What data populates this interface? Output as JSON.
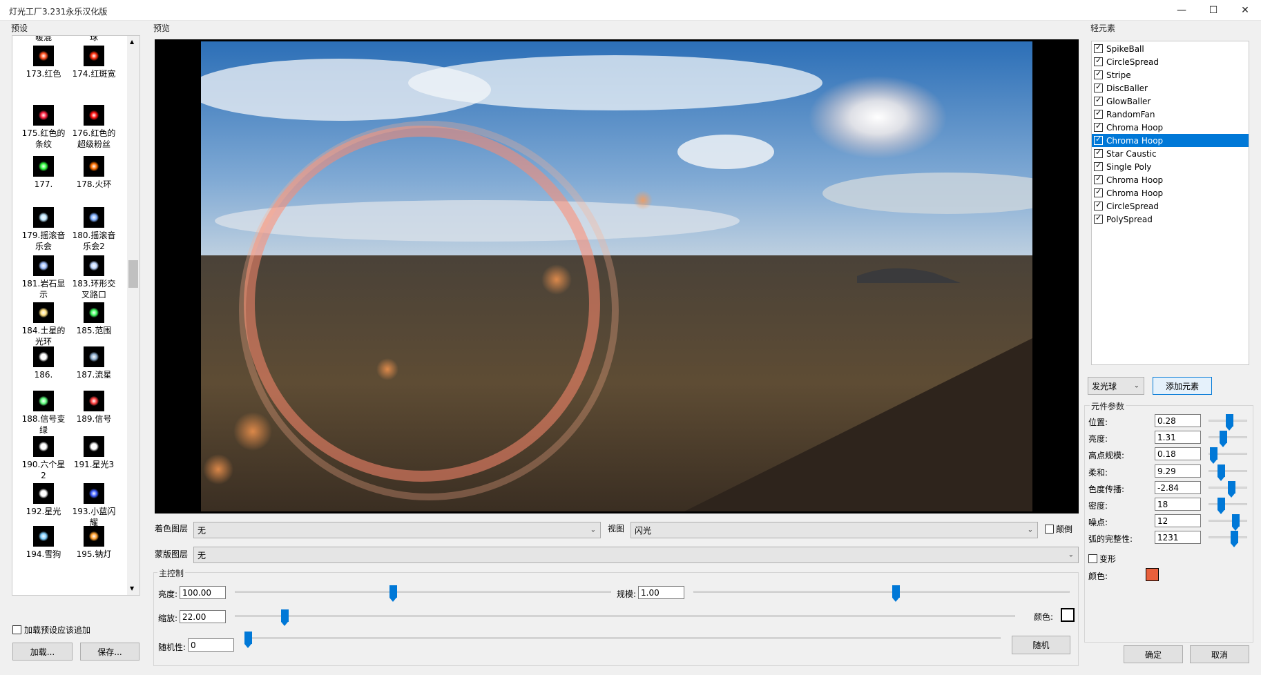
{
  "window": {
    "title": "灯光工厂3.231永乐汉化版"
  },
  "presets": {
    "group_label": "预设",
    "top_partial": [
      "暖混",
      "球"
    ],
    "items": [
      {
        "label": "173.红色",
        "glow": "#ff5020"
      },
      {
        "label": "174.红斑宽",
        "glow": "#ff3010"
      },
      {
        "label": "175.红色的条纹",
        "glow": "#ff2040"
      },
      {
        "label": "176.红色的超级粉丝",
        "glow": "#ff1010"
      },
      {
        "label": "177.",
        "glow": "#30ff40"
      },
      {
        "label": "178.火环",
        "glow": "#ff7000"
      },
      {
        "label": "179.摇滚音乐会",
        "glow": "#c0e8ff"
      },
      {
        "label": "180.摇滚音乐会2",
        "glow": "#80b0ff"
      },
      {
        "label": "181.岩石显示",
        "glow": "#a0c0ff"
      },
      {
        "label": "183.环形交叉路口",
        "glow": "#c0d8ff"
      },
      {
        "label": "184.土星的光环",
        "glow": "#ffe080"
      },
      {
        "label": "185.范围",
        "glow": "#40ff60"
      },
      {
        "label": "186.",
        "glow": "#ffffff"
      },
      {
        "label": "187.流星",
        "glow": "#90b0d0"
      },
      {
        "label": "188.信号变绿",
        "glow": "#60ff80"
      },
      {
        "label": "189.信号",
        "glow": "#ff4040"
      },
      {
        "label": "190.六个星 2",
        "glow": "#ffffff"
      },
      {
        "label": "191.星光3",
        "glow": "#ffffff"
      },
      {
        "label": "192.星光",
        "glow": "#ffffff"
      },
      {
        "label": "193.小蓝闪耀",
        "glow": "#4060ff"
      },
      {
        "label": "194.雪狗",
        "glow": "#80d0ff"
      },
      {
        "label": "195.钠灯",
        "glow": "#ffa030"
      }
    ],
    "append_checkbox": "加载预设应该追加",
    "load_button": "加载...",
    "save_button": "保存..."
  },
  "preview": {
    "group_label": "预览",
    "color_layer_label": "着色图层",
    "color_layer_value": "无",
    "view_label": "视图",
    "view_value": "闪光",
    "invert_label": "颠倒",
    "mask_layer_label": "蒙版图层",
    "mask_layer_value": "无"
  },
  "master": {
    "group_label": "主控制",
    "brightness_label": "亮度:",
    "brightness_value": "100.00",
    "brightness_level": 0.42,
    "scale_label": "规模:",
    "scale_value": "1.00",
    "scale_level": 0.54,
    "zoom_label": "缩放:",
    "zoom_value": "22.00",
    "zoom_level": 0.06,
    "color_label": "颜色:",
    "random_label": "随机性:",
    "random_value": "0",
    "random_level": 0.0,
    "random_button": "随机"
  },
  "elements": {
    "group_label": "轻元素",
    "items": [
      {
        "label": "SpikeBall",
        "selected": false
      },
      {
        "label": "CircleSpread",
        "selected": false
      },
      {
        "label": "Stripe",
        "selected": false
      },
      {
        "label": "DiscBaller",
        "selected": false
      },
      {
        "label": "GlowBaller",
        "selected": false
      },
      {
        "label": "RandomFan",
        "selected": false
      },
      {
        "label": "Chroma Hoop",
        "selected": false
      },
      {
        "label": "Chroma Hoop",
        "selected": true
      },
      {
        "label": "Star Caustic",
        "selected": false
      },
      {
        "label": "Single Poly",
        "selected": false
      },
      {
        "label": "Chroma Hoop",
        "selected": false
      },
      {
        "label": "Chroma Hoop",
        "selected": false
      },
      {
        "label": "CircleSpread",
        "selected": false
      },
      {
        "label": "PolySpread",
        "selected": false
      }
    ],
    "type_value": "发光球",
    "add_button": "添加元素"
  },
  "params": {
    "group_label": "元件参数",
    "rows": [
      {
        "label": "位置:",
        "value": "0.28",
        "level": 0.55
      },
      {
        "label": "亮度:",
        "value": "1.31",
        "level": 0.35
      },
      {
        "label": "高点规模:",
        "value": "0.18",
        "level": 0.05
      },
      {
        "label": "柔和:",
        "value": "9.29",
        "level": 0.28
      },
      {
        "label": "色度传播:",
        "value": "-2.84",
        "level": 0.62
      },
      {
        "label": "密度:",
        "value": "18",
        "level": 0.28
      },
      {
        "label": "噪点:",
        "value": "12",
        "level": 0.75
      },
      {
        "label": "弧的完整性:",
        "value": "1231",
        "level": 0.72
      }
    ],
    "deform_label": "变形",
    "color_label": "颜色:",
    "color_value": "#e8603c"
  },
  "footer": {
    "ok_button": "确定",
    "cancel_button": "取消"
  }
}
